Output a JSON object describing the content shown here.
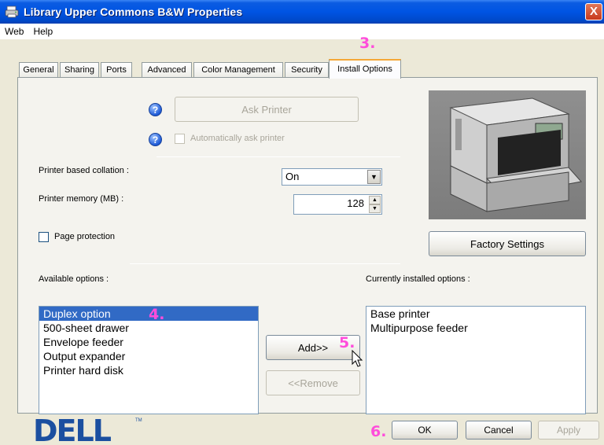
{
  "window": {
    "title": "Library Upper Commons B&W Properties",
    "close_symbol": "X",
    "title_icon": "printer-icon"
  },
  "menu": [
    "Web",
    "Help"
  ],
  "tabs": [
    {
      "label": "General"
    },
    {
      "label": "Sharing"
    },
    {
      "label": "Ports"
    },
    {
      "label": "Advanced"
    },
    {
      "label": "Color Management"
    },
    {
      "label": "Security"
    },
    {
      "label": "Install Options",
      "active": true
    }
  ],
  "ask_printer": {
    "button_label": "Ask Printer",
    "auto_checkbox_label": "Automatically ask printer",
    "help_symbol": "?"
  },
  "collation": {
    "label": "Printer based collation :",
    "value": "On"
  },
  "memory": {
    "label": "Printer memory (MB) :",
    "value": "128"
  },
  "page_protection": {
    "label": "Page protection"
  },
  "factory_settings_label": "Factory Settings",
  "available": {
    "label": "Available options :",
    "items": [
      "Duplex option",
      "500-sheet drawer",
      "Envelope feeder",
      "Output expander",
      "Printer hard disk"
    ],
    "selected_index": 0
  },
  "installed": {
    "label": "Currently installed options :",
    "items": [
      "Base printer",
      "Multipurpose feeder"
    ]
  },
  "buttons": {
    "add": "Add>>",
    "remove": "<<Remove",
    "ok": "OK",
    "cancel": "Cancel",
    "apply": "Apply"
  },
  "steps": {
    "s3": "3.",
    "s4": "4.",
    "s5": "5.",
    "s6": "6."
  },
  "brand": {
    "logo_text": "DELL",
    "tm": "TM"
  },
  "colors": {
    "titlebar": "#0054e3",
    "selection": "#316ac5",
    "step_annotation": "#ff4ddb",
    "dell_blue": "#1b4fa0"
  }
}
